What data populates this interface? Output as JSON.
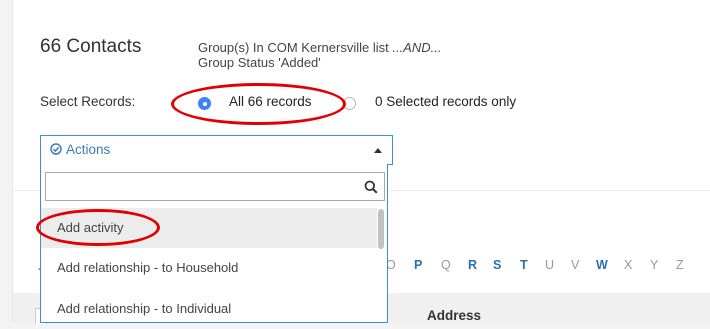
{
  "page": {
    "title": "66 Contacts",
    "criteria_line1_prefix": "Group(s) In COM Kernersville list ",
    "criteria_line1_em": "...AND...",
    "criteria_line2": "Group Status 'Added'"
  },
  "select_records": {
    "label": "Select Records:",
    "option_all": "All 66 records",
    "option_selected": "0 Selected records only",
    "selected": "all"
  },
  "actions": {
    "label": "Actions",
    "search_value": "",
    "options": [
      "Add activity",
      "Add relationship - to Household",
      "Add relationship - to Individual"
    ],
    "highlighted_index": 0
  },
  "alphabet": [
    "O",
    "P",
    "Q",
    "R",
    "S",
    "T",
    "U",
    "V",
    "W",
    "X",
    "Y",
    "Z"
  ],
  "alphabet_active": [
    "P",
    "R",
    "S",
    "T",
    "W"
  ],
  "table": {
    "address_header": "Address"
  },
  "colors": {
    "link_blue": "#2a6fb0",
    "inactive_letter": "#999999",
    "annotation_red": "#e00000",
    "radio_checked": "#3b82f6"
  }
}
